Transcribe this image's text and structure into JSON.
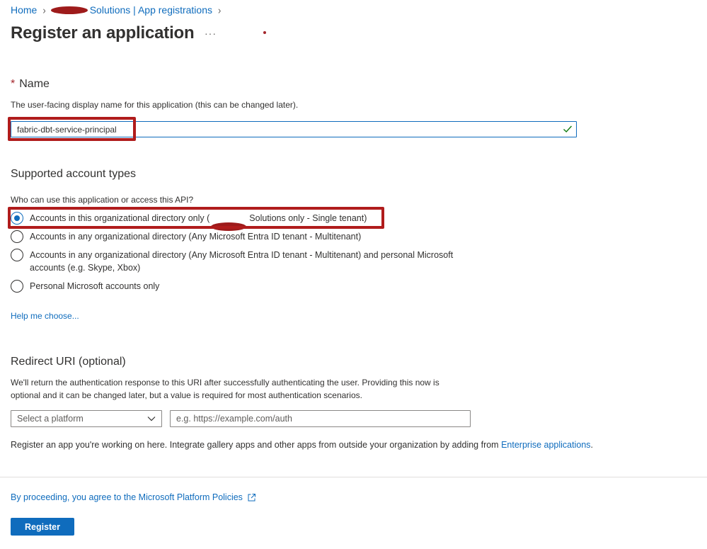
{
  "breadcrumb": {
    "home": "Home",
    "parent": "Solutions | App registrations"
  },
  "page": {
    "title": "Register an application",
    "more_icon": "ellipsis-icon"
  },
  "name_section": {
    "required_mark": "*",
    "heading": "Name",
    "description": "The user-facing display name for this application (this can be changed later).",
    "value": "fabric-dbt-service-principal",
    "valid_icon": "checkmark-icon"
  },
  "account_types": {
    "heading": "Supported account types",
    "question": "Who can use this application or access this API?",
    "options": [
      {
        "label_pre": "Accounts in this organizational directory only (",
        "label_post": "Solutions only - Single tenant)",
        "selected": true
      },
      {
        "label": "Accounts in any organizational directory (Any Microsoft Entra ID tenant - Multitenant)",
        "selected": false
      },
      {
        "label_line1": "Accounts in any organizational directory (Any Microsoft Entra ID tenant - Multitenant) and personal Microsoft",
        "label_line2": "accounts (e.g. Skype, Xbox)",
        "selected": false
      },
      {
        "label": "Personal Microsoft accounts only",
        "selected": false
      }
    ],
    "help_link": "Help me choose..."
  },
  "redirect": {
    "heading": "Redirect URI (optional)",
    "description_line1": "We'll return the authentication response to this URI after successfully authenticating the user. Providing this now is",
    "description_line2": "optional and it can be changed later, but a value is required for most authentication scenarios.",
    "platform_placeholder": "Select a platform",
    "uri_placeholder": "e.g. https://example.com/auth"
  },
  "gallery_note": {
    "text": "Register an app you're working on here. Integrate gallery apps and other apps from outside your organization by adding from ",
    "link": "Enterprise applications",
    "suffix": "."
  },
  "footer": {
    "policy_link": "By proceeding, you agree to the Microsoft Platform Policies",
    "policy_icon": "external-link-icon",
    "register_label": "Register"
  },
  "colors": {
    "accent": "#0f6cbd",
    "annotation": "#b01c1c",
    "required": "#a4262c",
    "valid": "#107c10"
  }
}
